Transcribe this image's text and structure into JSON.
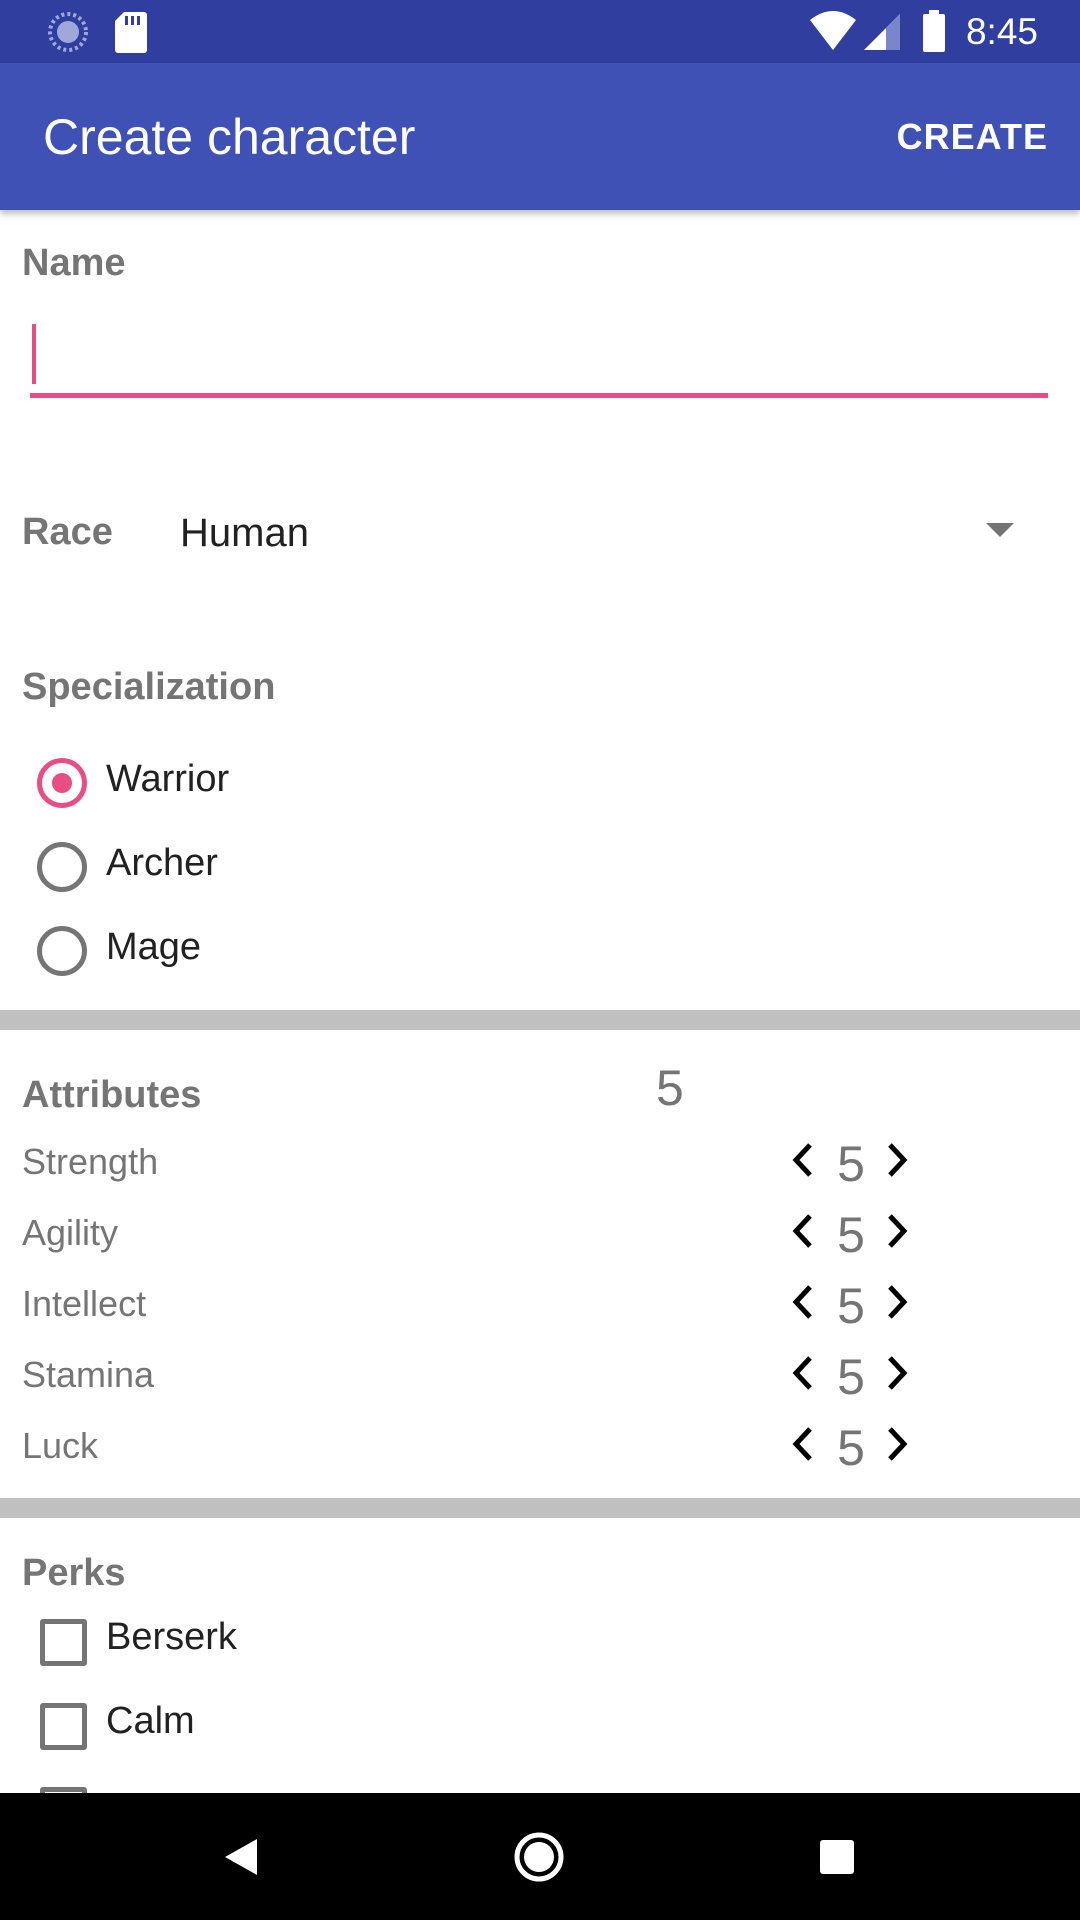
{
  "status_bar": {
    "time": "8:45",
    "icons": [
      "sync-icon",
      "sd-card-icon",
      "wifi-icon",
      "signal-icon",
      "battery-icon"
    ]
  },
  "app_bar": {
    "title": "Create character",
    "action_label": "CREATE"
  },
  "form": {
    "name": {
      "label": "Name",
      "value": ""
    },
    "race": {
      "label": "Race",
      "selected": "Human"
    },
    "specialization": {
      "label": "Specialization",
      "options": [
        {
          "label": "Warrior",
          "checked": true
        },
        {
          "label": "Archer",
          "checked": false
        },
        {
          "label": "Mage",
          "checked": false
        }
      ]
    },
    "attributes": {
      "label": "Attributes",
      "points": "5",
      "items": [
        {
          "name": "Strength",
          "value": "5"
        },
        {
          "name": "Agility",
          "value": "5"
        },
        {
          "name": "Intellect",
          "value": "5"
        },
        {
          "name": "Stamina",
          "value": "5"
        },
        {
          "name": "Luck",
          "value": "5"
        }
      ]
    },
    "perks": {
      "label": "Perks",
      "items": [
        {
          "label": "Berserk",
          "checked": false
        },
        {
          "label": "Calm",
          "checked": false
        }
      ]
    }
  },
  "colors": {
    "status_bar": "#303f9f",
    "app_bar": "#3f51b5",
    "accent": "#e94e83",
    "secondary_text": "#757575",
    "divider": "#c0c0c0"
  }
}
